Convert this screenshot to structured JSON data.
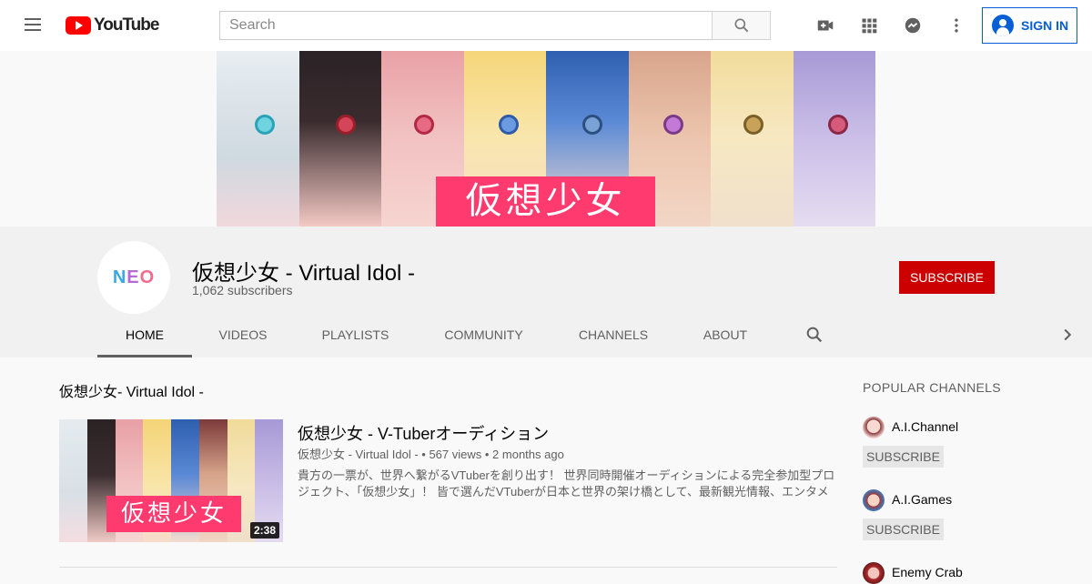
{
  "header": {
    "logo_text": "YouTube",
    "search_placeholder": "Search",
    "signin_label": "SIGN IN",
    "icons": [
      "menu-icon",
      "search-icon",
      "video-camera-icon",
      "apps-grid-icon",
      "messages-icon",
      "more-vert-icon",
      "account-circle-icon"
    ]
  },
  "banner": {
    "title": "仮想少女"
  },
  "channel": {
    "avatar_text": {
      "n": "N",
      "e": "E",
      "o": "O"
    },
    "name": "仮想少女 - Virtual Idol -",
    "subscribers": "1,062 subscribers",
    "subscribe_label": "SUBSCRIBE",
    "tabs": [
      {
        "label": "HOME",
        "active": true
      },
      {
        "label": "VIDEOS",
        "active": false
      },
      {
        "label": "PLAYLISTS",
        "active": false
      },
      {
        "label": "COMMUNITY",
        "active": false
      },
      {
        "label": "CHANNELS",
        "active": false
      },
      {
        "label": "ABOUT",
        "active": false
      }
    ]
  },
  "main": {
    "section_title": "仮想少女- Virtual Idol -",
    "video": {
      "thumb_title": "仮想少女",
      "duration": "2:38",
      "title": "仮想少女 - V-Tuberオーディション",
      "meta": "仮想少女 - Virtual Idol - • 567 views • 2 months ago",
      "description": "貴方の一票が、世界へ繋がるVTuberを創り出す！ 世界同時開催オーディションによる完全参加型プロジェクト、「仮想少女」！ 皆で選んだVTuberが日本と世界の架け橋として、最新観光情報、エンタメ"
    }
  },
  "sidebar": {
    "title": "POPULAR CHANNELS",
    "subscribe_label": "SUBSCRIBE",
    "channels": [
      {
        "name": "A.I.Channel"
      },
      {
        "name": "A.I.Games"
      },
      {
        "name": "Enemy Crab"
      }
    ]
  },
  "colors": {
    "brand_red": "#ff0000",
    "subscribe_red": "#cc0000",
    "link_blue": "#065fd4",
    "banner_pink": "#ff3a6e"
  }
}
